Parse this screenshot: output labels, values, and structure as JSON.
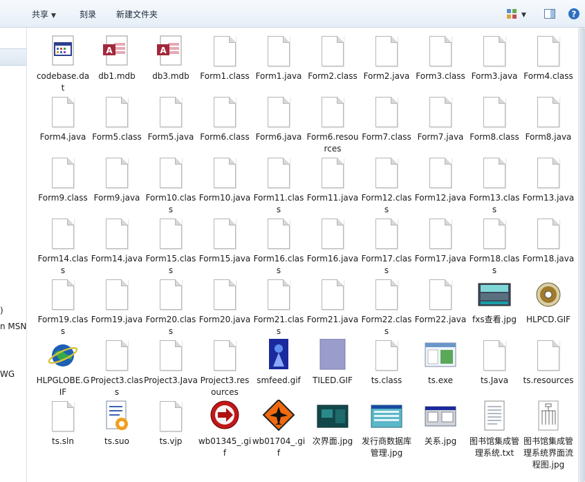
{
  "toolbar": {
    "share_label": "共享",
    "burn_label": "刻录",
    "new_folder_label": "新建文件夹"
  },
  "sidebar": {
    "items": [
      {
        "label": ")"
      },
      {
        "label": "n MSN"
      },
      {
        "label": "WG"
      }
    ]
  },
  "files": [
    {
      "name": "codebase.dat",
      "icon": "dat"
    },
    {
      "name": "db1.mdb",
      "icon": "mdb"
    },
    {
      "name": "db3.mdb",
      "icon": "mdb"
    },
    {
      "name": "Form1.class",
      "icon": "blank"
    },
    {
      "name": "Form1.java",
      "icon": "blank"
    },
    {
      "name": "Form2.class",
      "icon": "blank"
    },
    {
      "name": "Form2.java",
      "icon": "blank"
    },
    {
      "name": "Form3.class",
      "icon": "blank"
    },
    {
      "name": "Form3.java",
      "icon": "blank"
    },
    {
      "name": "Form4.class",
      "icon": "blank"
    },
    {
      "name": "Form4.java",
      "icon": "blank"
    },
    {
      "name": "Form5.class",
      "icon": "blank"
    },
    {
      "name": "Form5.java",
      "icon": "blank"
    },
    {
      "name": "Form6.class",
      "icon": "blank"
    },
    {
      "name": "Form6.java",
      "icon": "blank"
    },
    {
      "name": "Form6.resources",
      "icon": "blank"
    },
    {
      "name": "Form7.class",
      "icon": "blank"
    },
    {
      "name": "Form7.java",
      "icon": "blank"
    },
    {
      "name": "Form8.class",
      "icon": "blank"
    },
    {
      "name": "Form8.java",
      "icon": "blank"
    },
    {
      "name": "Form9.class",
      "icon": "blank"
    },
    {
      "name": "Form9.java",
      "icon": "blank"
    },
    {
      "name": "Form10.class",
      "icon": "blank"
    },
    {
      "name": "Form10.java",
      "icon": "blank"
    },
    {
      "name": "Form11.class",
      "icon": "blank"
    },
    {
      "name": "Form11.java",
      "icon": "blank"
    },
    {
      "name": "Form12.class",
      "icon": "blank"
    },
    {
      "name": "Form12.java",
      "icon": "blank"
    },
    {
      "name": "Form13.class",
      "icon": "blank"
    },
    {
      "name": "Form13.java",
      "icon": "blank"
    },
    {
      "name": "Form14.class",
      "icon": "blank"
    },
    {
      "name": "Form14.java",
      "icon": "blank"
    },
    {
      "name": "Form15.class",
      "icon": "blank"
    },
    {
      "name": "Form15.java",
      "icon": "blank"
    },
    {
      "name": "Form16.class",
      "icon": "blank"
    },
    {
      "name": "Form16.java",
      "icon": "blank"
    },
    {
      "name": "Form17.class",
      "icon": "blank"
    },
    {
      "name": "Form17.java",
      "icon": "blank"
    },
    {
      "name": "Form18.class",
      "icon": "blank"
    },
    {
      "name": "Form18.java",
      "icon": "blank"
    },
    {
      "name": "Form19.class",
      "icon": "blank"
    },
    {
      "name": "Form19.java",
      "icon": "blank"
    },
    {
      "name": "Form20.class",
      "icon": "blank"
    },
    {
      "name": "Form20.java",
      "icon": "blank"
    },
    {
      "name": "Form21.class",
      "icon": "blank"
    },
    {
      "name": "Form21.java",
      "icon": "blank"
    },
    {
      "name": "Form22.class",
      "icon": "blank"
    },
    {
      "name": "Form22.java",
      "icon": "blank"
    },
    {
      "name": "fxs查看.jpg",
      "icon": "jpg-screen"
    },
    {
      "name": "HLPCD.GIF",
      "icon": "cd"
    },
    {
      "name": "HLPGLOBE.GIF",
      "icon": "globe"
    },
    {
      "name": "Project3.class",
      "icon": "blank"
    },
    {
      "name": "Project3.Java",
      "icon": "blank"
    },
    {
      "name": "Project3.resources",
      "icon": "blank"
    },
    {
      "name": "smfeed.gif",
      "icon": "smfeed"
    },
    {
      "name": "TILED.GIF",
      "icon": "tiled"
    },
    {
      "name": "ts.class",
      "icon": "blank"
    },
    {
      "name": "ts.exe",
      "icon": "exe"
    },
    {
      "name": "ts.Java",
      "icon": "blank"
    },
    {
      "name": "ts.resources",
      "icon": "blank"
    },
    {
      "name": "ts.sln",
      "icon": "blank"
    },
    {
      "name": "ts.suo",
      "icon": "suo"
    },
    {
      "name": "ts.vjp",
      "icon": "blank"
    },
    {
      "name": "wb01345_.gif",
      "icon": "wb-red"
    },
    {
      "name": "wb01704_.gif",
      "icon": "wb-orange"
    },
    {
      "name": "次界面.jpg",
      "icon": "jpg-dark"
    },
    {
      "name": "发行商数据库管理.jpg",
      "icon": "jpg-window"
    },
    {
      "name": "关系.jpg",
      "icon": "jpg-gray"
    },
    {
      "name": "图书馆集成管理系统.txt",
      "icon": "txt"
    },
    {
      "name": "图书馆集成管理系统界面流程图.jpg",
      "icon": "jpg-flow"
    }
  ]
}
